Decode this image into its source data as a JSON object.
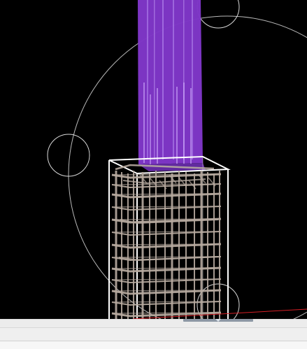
{
  "viewport": {
    "background_color": "#000000",
    "column_color": "#7e36c7",
    "column_highlight_color": "#b78cf0",
    "rebar_color": "#b7aaa0",
    "outline_color": "#ffffff",
    "guide_color": "#d9d9d9",
    "red_line_color": "#d61f26"
  },
  "bottom_panel": {
    "scrollbar_color": "#8d98a5",
    "background_color": "#f3f3f3"
  }
}
